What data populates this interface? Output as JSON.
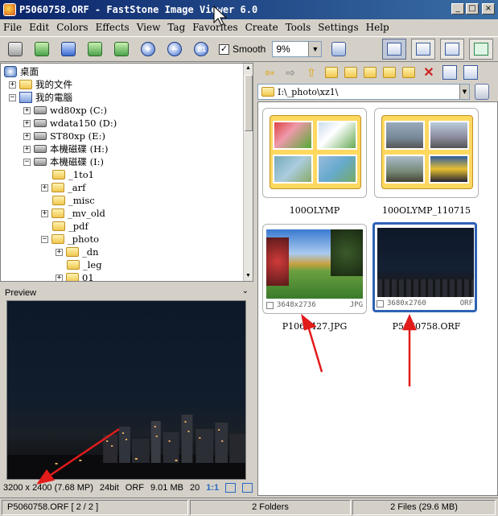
{
  "window": {
    "title": "P5060758.ORF  -  FastStone Image Viewer 6.0",
    "min": "_",
    "max": "□",
    "close": "×"
  },
  "menu": [
    "File",
    "Edit",
    "Colors",
    "Effects",
    "View",
    "Tag",
    "Favorites",
    "Create",
    "Tools",
    "Settings",
    "Help"
  ],
  "toolbar": {
    "smooth_label": "Smooth",
    "smooth_checked": "✓",
    "zoom_value": "9%"
  },
  "tree": {
    "items": [
      {
        "label": "桌面"
      },
      {
        "label": "我的文件"
      },
      {
        "label": "我的電腦"
      },
      {
        "label": "wd80xp (C:)"
      },
      {
        "label": "wdata150 (D:)"
      },
      {
        "label": "ST80xp (E:)"
      },
      {
        "label": "本機磁碟 (H:)"
      },
      {
        "label": "本機磁碟 (I:)"
      },
      {
        "label": "_1to1"
      },
      {
        "label": "_arf"
      },
      {
        "label": "_misc"
      },
      {
        "label": "_mv_old"
      },
      {
        "label": "_pdf"
      },
      {
        "label": "_photo"
      },
      {
        "label": "_dn"
      },
      {
        "label": "_leg"
      },
      {
        "label": "01"
      }
    ]
  },
  "preview": {
    "header": "Preview",
    "info": {
      "resolution": "3200 x 2400 (7.68 MP)",
      "bitdepth": "24bit",
      "format": "ORF",
      "size": "9.01 MB",
      "zoom": "20",
      "ratio": "1:1"
    }
  },
  "browser": {
    "path": "I:\\_photo\\xz1\\",
    "items": [
      {
        "label": "100OLYMP"
      },
      {
        "label": "100OLYMP_110715"
      },
      {
        "label": "P1060427.JPG",
        "dims": "3648x2736",
        "ext": "JPG"
      },
      {
        "label": "P5060758.ORF",
        "dims": "3680x2760",
        "ext": "ORF"
      }
    ]
  },
  "status": {
    "file": "P5060758.ORF [ 2 / 2 ]",
    "folders": "2 Folders",
    "files": "2 Files (29.6 MB)"
  },
  "colors": {
    "title_start": "#0a246a",
    "title_end": "#3a6ea5",
    "selection_border": "#2f62b4",
    "annotation_arrow": "#e21b1b"
  }
}
